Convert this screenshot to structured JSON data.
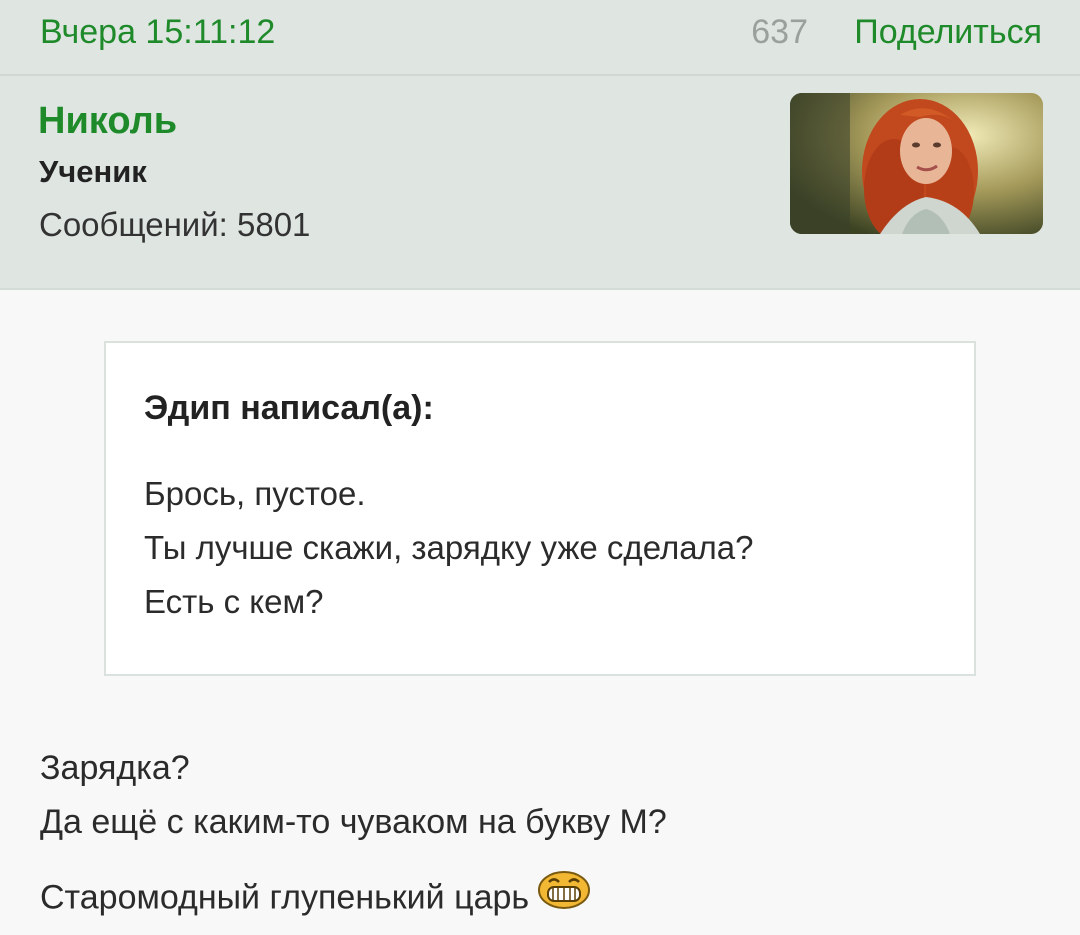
{
  "post": {
    "timestamp": "Вчера 15:11:12",
    "views": "637",
    "share_label": "Поделиться"
  },
  "author": {
    "name": "Николь",
    "rank": "Ученик",
    "posts_count": "Сообщений: 5801"
  },
  "quote": {
    "author_line": "Эдип написал(а):",
    "lines": [
      "Брось, пустое.",
      "Ты лучше скажи, зарядку уже сделала?",
      "Есть с кем?"
    ]
  },
  "message": {
    "lines": [
      "Зарядка?",
      "Да ещё с каким-то чуваком на букву М?",
      "Старомодный глупенький царь"
    ],
    "emoji_icon": "laughing-smiley-icon"
  },
  "colors": {
    "accent_green": "#1f8a2a",
    "header_bg": "#dfe6e2",
    "content_bg": "#f7f8f7"
  }
}
